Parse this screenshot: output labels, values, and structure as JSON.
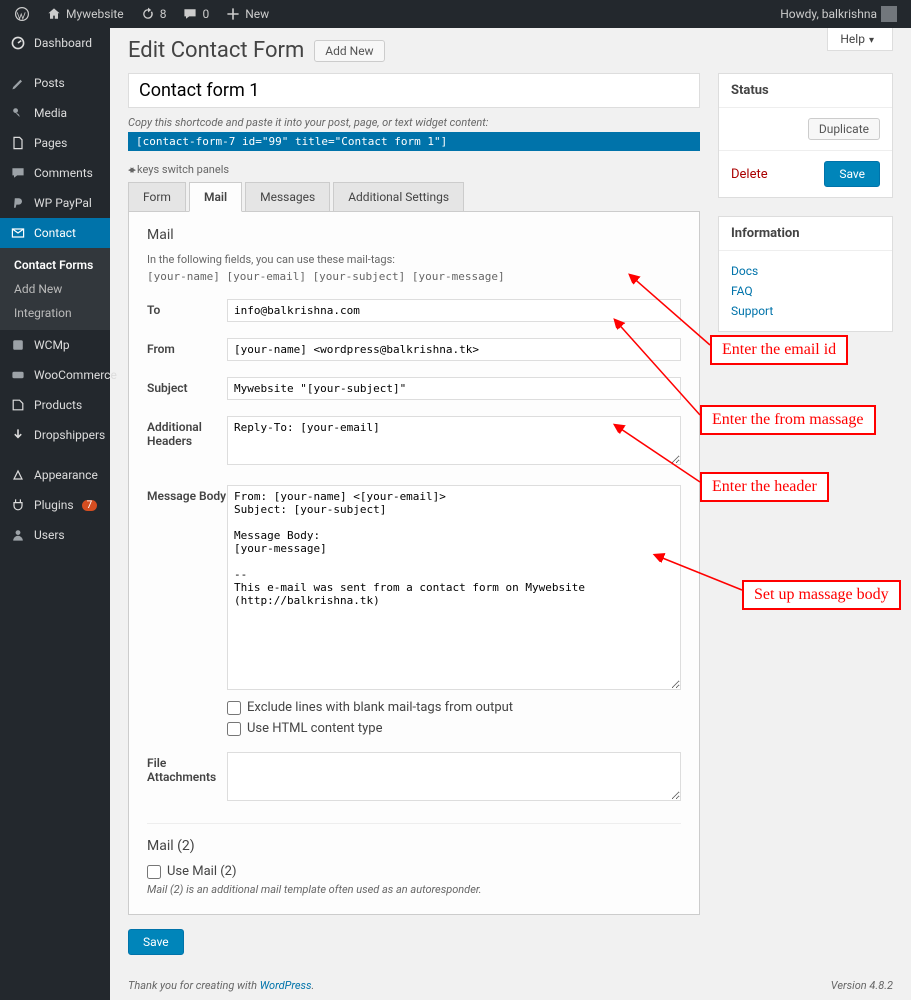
{
  "adminbar": {
    "site": "Mywebsite",
    "refresh": "8",
    "comments": "0",
    "new": "New",
    "howdy": "Howdy, balkrishna"
  },
  "sidebar": {
    "items": [
      {
        "label": "Dashboard"
      },
      {
        "label": "Posts"
      },
      {
        "label": "Media"
      },
      {
        "label": "Pages"
      },
      {
        "label": "Comments"
      },
      {
        "label": "WP PayPal"
      },
      {
        "label": "Contact"
      },
      {
        "label": "WCMp"
      },
      {
        "label": "WooCommerce"
      },
      {
        "label": "Products"
      },
      {
        "label": "Dropshippers"
      },
      {
        "label": "Appearance"
      },
      {
        "label": "Plugins",
        "badge": "7"
      },
      {
        "label": "Users"
      }
    ],
    "sub": [
      {
        "label": "Contact Forms"
      },
      {
        "label": "Add New"
      },
      {
        "label": "Integration"
      }
    ]
  },
  "page": {
    "title": "Edit Contact Form",
    "add_new": "Add New",
    "help": "Help",
    "form_title": "Contact form 1",
    "shortcode_note": "Copy this shortcode and paste it into your post, page, or text widget content:",
    "shortcode": "[contact-form-7 id=\"99\" title=\"Contact form 1\"]",
    "switch": "keys switch panels"
  },
  "tabs": [
    "Form",
    "Mail",
    "Messages",
    "Additional Settings"
  ],
  "mail": {
    "heading": "Mail",
    "desc": "In the following fields, you can use these mail-tags:",
    "tags": "[your-name] [your-email] [your-subject] [your-message]",
    "to": {
      "label": "To",
      "value": "info@balkrishna.com"
    },
    "from": {
      "label": "From",
      "value": "[your-name] <wordpress@balkrishna.tk>"
    },
    "subject": {
      "label": "Subject",
      "value": "Mywebsite \"[your-subject]\""
    },
    "headers": {
      "label": "Additional Headers",
      "value": "Reply-To: [your-email]"
    },
    "body": {
      "label": "Message Body",
      "value": "From: [your-name] <[your-email]>\nSubject: [your-subject]\n\nMessage Body:\n[your-message]\n\n--\nThis e-mail was sent from a contact form on Mywebsite (http://balkrishna.tk)"
    },
    "exclude": "Exclude lines with blank mail-tags from output",
    "html": "Use HTML content type",
    "attach": {
      "label": "File Attachments",
      "value": ""
    },
    "mail2": {
      "heading": "Mail (2)",
      "use": "Use Mail (2)",
      "note": "Mail (2) is an additional mail template often used as an autoresponder."
    }
  },
  "status": {
    "title": "Status",
    "dup": "Duplicate",
    "delete": "Delete",
    "save": "Save"
  },
  "info": {
    "title": "Information",
    "links": [
      "Docs",
      "FAQ",
      "Support"
    ]
  },
  "save": "Save",
  "footer": {
    "thank": "Thank you for creating with ",
    "wp": "WordPress",
    "dot": ".",
    "ver": "Version 4.8.2"
  },
  "callouts": [
    "Enter the email id",
    "Enter the from massage",
    "Enter the header",
    "Set up massage body"
  ]
}
